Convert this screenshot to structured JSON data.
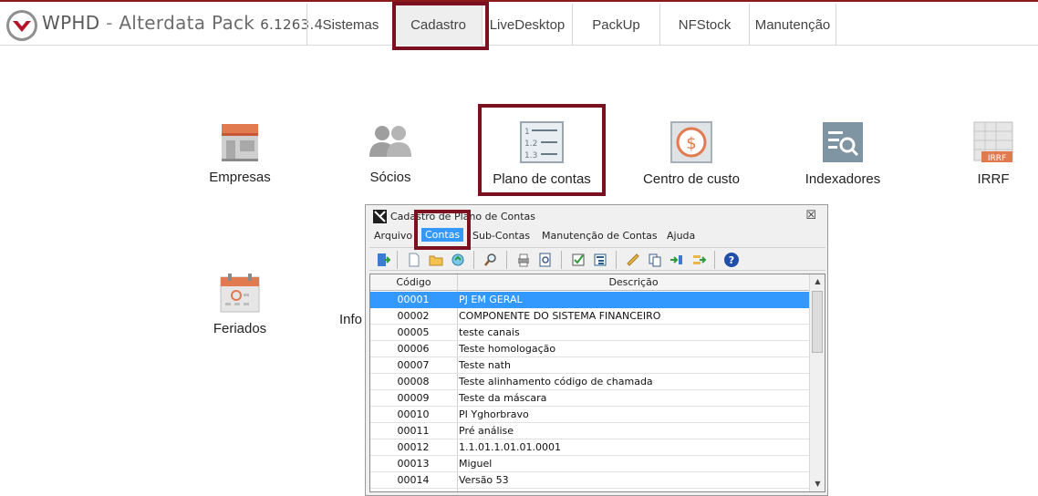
{
  "app": {
    "brand_name": "WPHD",
    "brand_sep": " - ",
    "brand_product": "Alterdata Pack",
    "version": "6.1263.4"
  },
  "menu": [
    {
      "label": "Sistemas"
    },
    {
      "label": "Cadastro"
    },
    {
      "label": "LiveDesktop"
    },
    {
      "label": "PackUp"
    },
    {
      "label": "NFStock"
    },
    {
      "label": "Manutenção"
    }
  ],
  "tiles": [
    {
      "label": "Empresas",
      "icon": "building-icon"
    },
    {
      "label": "Sócios",
      "icon": "partners-icon"
    },
    {
      "label": "Plano de contas",
      "icon": "numbered-list-icon"
    },
    {
      "label": "Centro de custo",
      "icon": "dollar-coin-icon"
    },
    {
      "label": "Indexadores",
      "icon": "search-list-icon"
    },
    {
      "label": "IRRF",
      "icon": "irrf-table-icon"
    },
    {
      "label": "Feriados",
      "icon": "calendar-icon"
    },
    {
      "label": "Info",
      "icon": ""
    }
  ],
  "dialog": {
    "title": "Cadastro de Plano de Contas",
    "close_glyph": "☒",
    "menu": [
      "Arquivo",
      "Contas",
      "Sub-Contas",
      "Manutenção de Contas",
      "Ajuda"
    ],
    "toolbar_icons": [
      "exit-icon",
      "new-document-icon",
      "open-folder-icon",
      "refresh-icon",
      "find-icon",
      "print-icon",
      "print-preview-icon",
      "check-list-icon",
      "tree-list-icon",
      "ruler-icon",
      "copy-icon",
      "insert-sub-icon",
      "move-icon",
      "help-icon"
    ],
    "grid": {
      "columns": [
        "Código",
        "Descrição"
      ],
      "selected_index": 0,
      "rows": [
        {
          "code": "00001",
          "desc": "PJ EM GERAL"
        },
        {
          "code": "00002",
          "desc": "COMPONENTE DO SISTEMA FINANCEIRO"
        },
        {
          "code": "00005",
          "desc": "teste canais"
        },
        {
          "code": "00006",
          "desc": "Teste homologação"
        },
        {
          "code": "00007",
          "desc": "Teste nath"
        },
        {
          "code": "00008",
          "desc": "Teste alinhamento código de chamada"
        },
        {
          "code": "00009",
          "desc": "Teste da máscara"
        },
        {
          "code": "00010",
          "desc": "PI Yghorbravo"
        },
        {
          "code": "00011",
          "desc": "Pré análise"
        },
        {
          "code": "00012",
          "desc": "1.1.01.1.01.01.0001"
        },
        {
          "code": "00013",
          "desc": "Miguel"
        },
        {
          "code": "00014",
          "desc": "Versão 53"
        }
      ]
    }
  },
  "colors": {
    "accent": "#7a1020",
    "selection": "#3399ff"
  }
}
